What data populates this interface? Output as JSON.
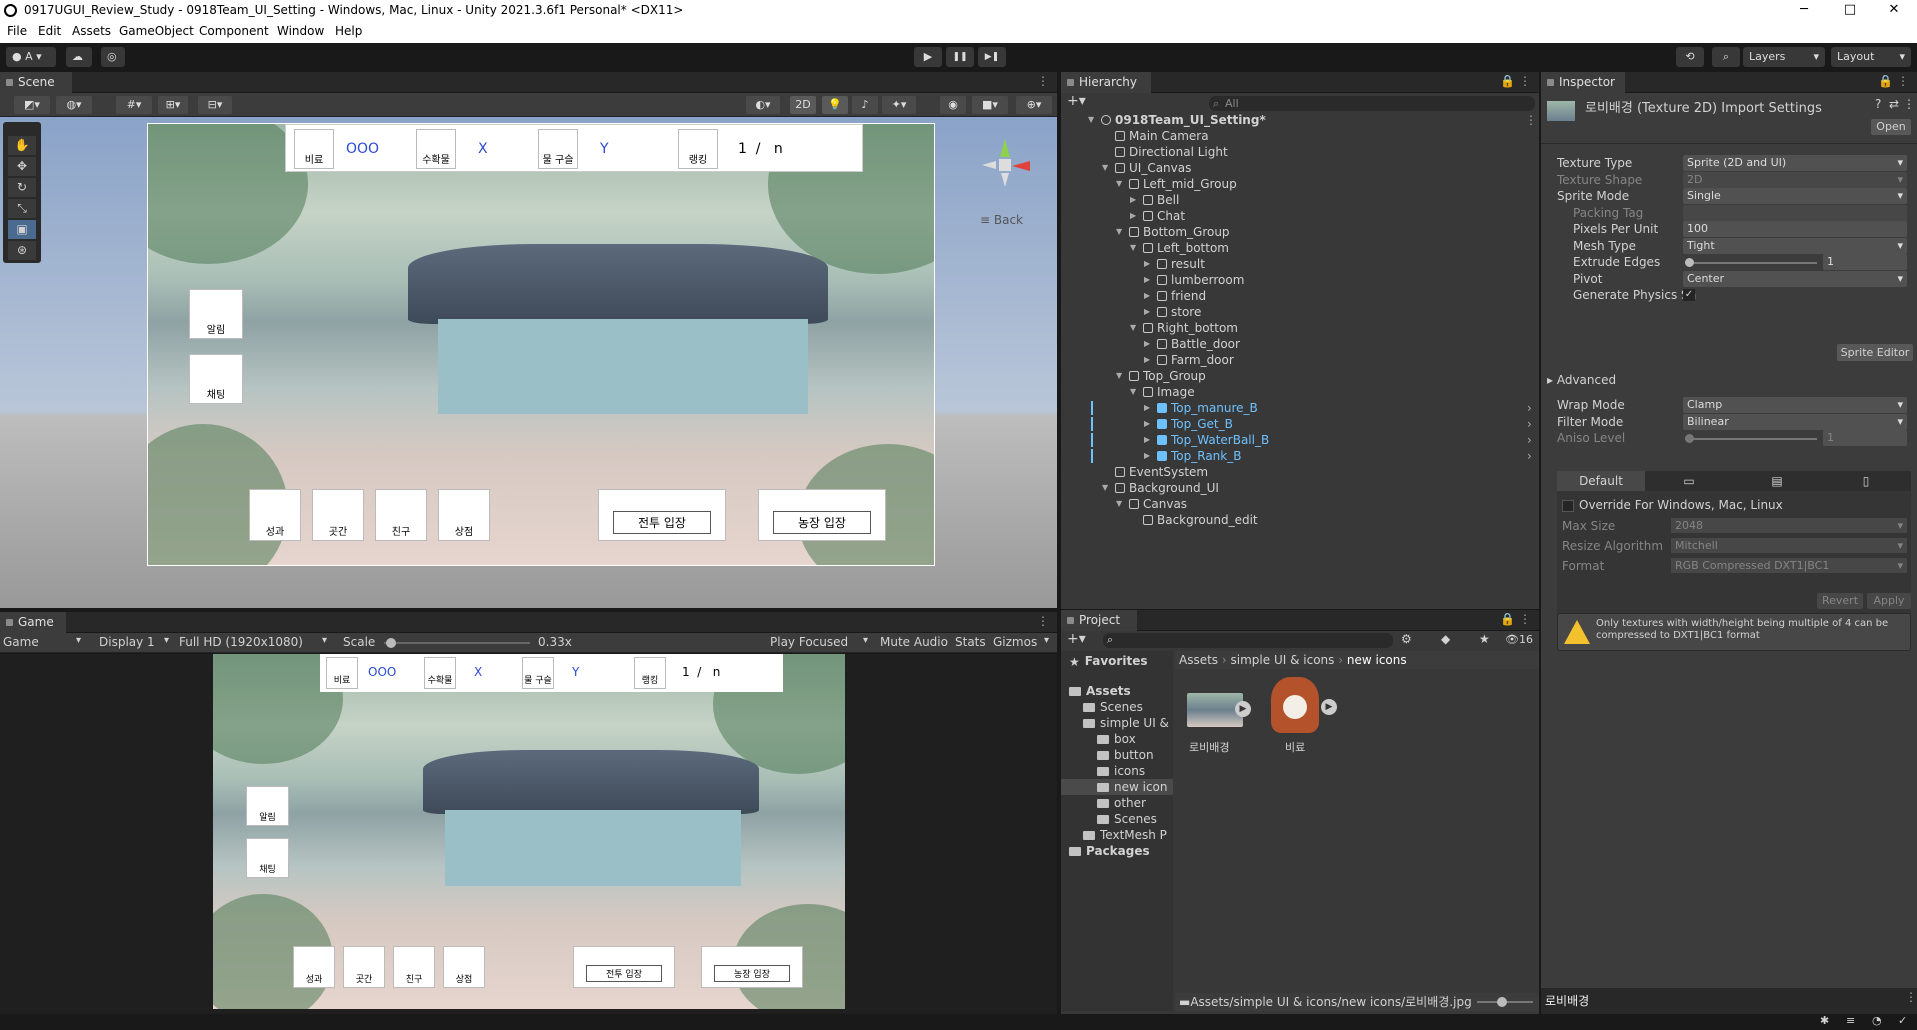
{
  "window": {
    "title": "0917UGUI_Review_Study - 0918Team_UI_Setting - Windows, Mac, Linux - Unity 2021.3.6f1 Personal* <DX11>",
    "minimize": "─",
    "maximize": "□",
    "close": "✕"
  },
  "menu": [
    "File",
    "Edit",
    "Assets",
    "GameObject",
    "Component",
    "Window",
    "Help"
  ],
  "toolbar": {
    "account": "A",
    "layers": "Layers",
    "layout": "Layout",
    "play": "▶",
    "pause": "❚❚",
    "step": "▶❚"
  },
  "scene": {
    "tab": "Scene",
    "mode2d": "2D",
    "back": "≡ Back",
    "ui_top": {
      "labels": [
        "비료",
        "수확물",
        "물 구슬",
        "랭킹"
      ],
      "values": [
        "OOO",
        "X",
        "Y",
        "1  /   n"
      ]
    },
    "ui_left": [
      "알림",
      "채팅"
    ],
    "ui_bottom": [
      "성과",
      "곳간",
      "친구",
      "상점"
    ],
    "ui_doors": [
      "전투 입장",
      "농장 입장"
    ]
  },
  "game": {
    "tab": "Game",
    "view": "Game",
    "display": "Display 1",
    "resolution": "Full HD (1920x1080)",
    "scale_label": "Scale",
    "scale_value": "0.33x",
    "scale_fraction": 0.05,
    "play_focused": "Play Focused",
    "mute": "Mute Audio",
    "stats": "Stats",
    "gizmos": "Gizmos"
  },
  "hierarchy": {
    "tab": "Hierarchy",
    "search": "All",
    "items": [
      {
        "label": "0918Team_UI_Setting*",
        "depth": 0,
        "arrow": "▼",
        "kind": "scene"
      },
      {
        "label": "Main Camera",
        "depth": 1,
        "arrow": "",
        "kind": "obj"
      },
      {
        "label": "Directional Light",
        "depth": 1,
        "arrow": "",
        "kind": "obj"
      },
      {
        "label": "UI_Canvas",
        "depth": 1,
        "arrow": "▼",
        "kind": "obj"
      },
      {
        "label": "Left_mid_Group",
        "depth": 2,
        "arrow": "▼",
        "kind": "obj"
      },
      {
        "label": "Bell",
        "depth": 3,
        "arrow": "▶",
        "kind": "obj"
      },
      {
        "label": "Chat",
        "depth": 3,
        "arrow": "▶",
        "kind": "obj"
      },
      {
        "label": "Bottom_Group",
        "depth": 2,
        "arrow": "▼",
        "kind": "obj"
      },
      {
        "label": "Left_bottom",
        "depth": 3,
        "arrow": "▼",
        "kind": "obj"
      },
      {
        "label": "result",
        "depth": 4,
        "arrow": "▶",
        "kind": "obj"
      },
      {
        "label": "lumberroom",
        "depth": 4,
        "arrow": "▶",
        "kind": "obj"
      },
      {
        "label": "friend",
        "depth": 4,
        "arrow": "▶",
        "kind": "obj"
      },
      {
        "label": "store",
        "depth": 4,
        "arrow": "▶",
        "kind": "obj"
      },
      {
        "label": "Right_bottom",
        "depth": 3,
        "arrow": "▼",
        "kind": "obj"
      },
      {
        "label": "Battle_door",
        "depth": 4,
        "arrow": "▶",
        "kind": "obj"
      },
      {
        "label": "Farm_door",
        "depth": 4,
        "arrow": "▶",
        "kind": "obj"
      },
      {
        "label": "Top_Group",
        "depth": 2,
        "arrow": "▼",
        "kind": "obj"
      },
      {
        "label": "Image",
        "depth": 3,
        "arrow": "▼",
        "kind": "obj"
      },
      {
        "label": "Top_manure_B",
        "depth": 4,
        "arrow": "▶",
        "kind": "prefab"
      },
      {
        "label": "Top_Get_B",
        "depth": 4,
        "arrow": "▶",
        "kind": "prefab"
      },
      {
        "label": "Top_WaterBall_B",
        "depth": 4,
        "arrow": "▶",
        "kind": "prefab"
      },
      {
        "label": "Top_Rank_B",
        "depth": 4,
        "arrow": "▶",
        "kind": "prefab"
      },
      {
        "label": "EventSystem",
        "depth": 1,
        "arrow": "",
        "kind": "obj"
      },
      {
        "label": "Background_UI",
        "depth": 1,
        "arrow": "▼",
        "kind": "obj"
      },
      {
        "label": "Canvas",
        "depth": 2,
        "arrow": "▼",
        "kind": "obj"
      },
      {
        "label": "Background_edit",
        "depth": 3,
        "arrow": "",
        "kind": "obj"
      }
    ]
  },
  "project": {
    "tab": "Project",
    "count": "16",
    "breadcrumb": [
      "Assets",
      "simple UI & icons",
      "new icons"
    ],
    "tree": [
      {
        "label": "Favorites",
        "depth": 0,
        "bold": true
      },
      {
        "label": "Assets",
        "depth": 0,
        "bold": true
      },
      {
        "label": "Scenes",
        "depth": 1
      },
      {
        "label": "simple UI &",
        "depth": 1
      },
      {
        "label": "box",
        "depth": 2
      },
      {
        "label": "button",
        "depth": 2
      },
      {
        "label": "icons",
        "depth": 2
      },
      {
        "label": "new icon",
        "depth": 2,
        "selected": true
      },
      {
        "label": "other",
        "depth": 2
      },
      {
        "label": "Scenes",
        "depth": 2
      },
      {
        "label": "TextMesh P",
        "depth": 1
      },
      {
        "label": "Packages",
        "depth": 0,
        "bold": true
      }
    ],
    "assets": [
      "로비배경",
      "비료"
    ],
    "path": "Assets/simple UI & icons/new icons/로비배경.jpg"
  },
  "inspector": {
    "tab": "Inspector",
    "title": "로비배경 (Texture 2D) Import Settings",
    "open": "Open",
    "rows": [
      {
        "label": "Texture Type",
        "value": "Sprite (2D and UI)",
        "dim": false,
        "dd": true
      },
      {
        "label": "Texture Shape",
        "value": "2D",
        "dim": true,
        "dd": true
      },
      {
        "label": "Sprite Mode",
        "value": "Single",
        "dim": false,
        "dd": true
      },
      {
        "label": "Packing Tag",
        "value": "",
        "dim": true,
        "indent": true
      },
      {
        "label": "Pixels Per Unit",
        "value": "100",
        "dim": false,
        "indent": true
      },
      {
        "label": "Mesh Type",
        "value": "Tight",
        "dim": false,
        "dd": true,
        "indent": true
      },
      {
        "label": "Extrude Edges",
        "value": "1",
        "dim": false,
        "slider": true,
        "indent": true
      },
      {
        "label": "Pivot",
        "value": "Center",
        "dim": false,
        "dd": true,
        "indent": true
      },
      {
        "label": "Generate Physics Sh",
        "value": "✓",
        "dim": false,
        "check": true,
        "indent": true
      }
    ],
    "sprite_editor": "Sprite Editor",
    "advanced": "Advanced",
    "rows2": [
      {
        "label": "Wrap Mode",
        "value": "Clamp",
        "dim": false,
        "dd": true
      },
      {
        "label": "Filter Mode",
        "value": "Bilinear",
        "dim": false,
        "dd": true
      },
      {
        "label": "Aniso Level",
        "value": "1",
        "dim": true,
        "slider": true
      }
    ],
    "platform_default": "Default",
    "override": "Override For Windows, Mac, Linux",
    "rows3": [
      {
        "label": "Max Size",
        "value": "2048"
      },
      {
        "label": "Resize Algorithm",
        "value": "Mitchell"
      },
      {
        "label": "Format",
        "value": "RGB Compressed DXT1|BC1"
      }
    ],
    "revert": "Revert",
    "apply": "Apply",
    "warning": "Only textures with width/height being multiple of 4 can be compressed to DXT1|BC1 format",
    "footer": "로비배경"
  },
  "colors": {
    "accent": "#6ec1ff",
    "panel": "#383838",
    "bg": "#191919"
  }
}
